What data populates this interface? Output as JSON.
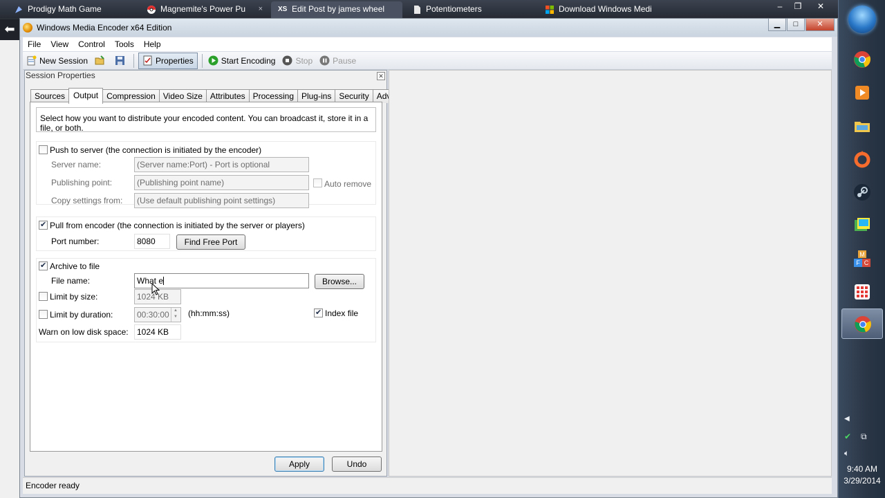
{
  "browser": {
    "tabs": [
      {
        "title": "Prodigy Math Game",
        "icon": "prodigy-icon"
      },
      {
        "title": "Magnemite's Power Pu",
        "icon": "pokeball-icon"
      },
      {
        "title": "Edit Post by james wheel",
        "icon": "xs-icon"
      },
      {
        "title": "Potentiometers",
        "icon": "document-icon"
      },
      {
        "title": "Download Windows Medi",
        "icon": "microsoft-icon"
      }
    ],
    "back_icon": "back-arrow-icon"
  },
  "app": {
    "title": "Windows Media Encoder x64 Edition",
    "menu": [
      "File",
      "View",
      "Control",
      "Tools",
      "Help"
    ],
    "toolbar": {
      "new_session": "New Session",
      "properties": "Properties",
      "start_encoding": "Start Encoding",
      "stop": "Stop",
      "pause": "Pause"
    },
    "status": "Encoder ready"
  },
  "session": {
    "title": "Session Properties",
    "tabs": [
      "Sources",
      "Output",
      "Compression",
      "Video Size",
      "Attributes",
      "Processing",
      "Plug-ins",
      "Security",
      "Advanced"
    ],
    "active_tab": "Output",
    "description": "Select how you want to distribute your encoded content. You can broadcast it, store it in a file, or both.",
    "push": {
      "label": "Push to server (the connection is initiated by the encoder)",
      "checked": false,
      "server_name_label": "Server name:",
      "server_name_value": "(Server name:Port)  - Port is optional",
      "publishing_point_label": "Publishing point:",
      "publishing_point_value": "(Publishing point name)",
      "auto_remove": "Auto remove",
      "copy_settings_label": "Copy settings from:",
      "copy_settings_value": "(Use default publishing point settings)"
    },
    "pull": {
      "label": "Pull from encoder (the connection is initiated by the server or players)",
      "checked": true,
      "port_label": "Port number:",
      "port_value": "8080",
      "find_free_port": "Find Free Port"
    },
    "archive": {
      "label": "Archive to file",
      "checked": true,
      "file_name_label": "File name:",
      "file_name_value": "What e",
      "browse": "Browse...",
      "limit_size_label": "Limit by size:",
      "limit_size_value": "1024 KB",
      "limit_duration_label": "Limit by duration:",
      "limit_duration_value": "00:30:00",
      "duration_format": "(hh:mm:ss)",
      "index_file": "Index file",
      "warn_label": "Warn on low disk space:",
      "warn_value": "1024 KB"
    },
    "buttons": {
      "apply": "Apply",
      "undo": "Undo"
    }
  },
  "taskbar": {
    "pinned": [
      "chrome-icon",
      "media-player-icon",
      "file-explorer-icon",
      "origin-icon",
      "steam-icon",
      "photo-gallery-icon",
      "mfc-icon",
      "apps-grid-icon",
      "chrome-active-icon"
    ],
    "time": "9:40 AM",
    "date": "3/29/2014"
  }
}
